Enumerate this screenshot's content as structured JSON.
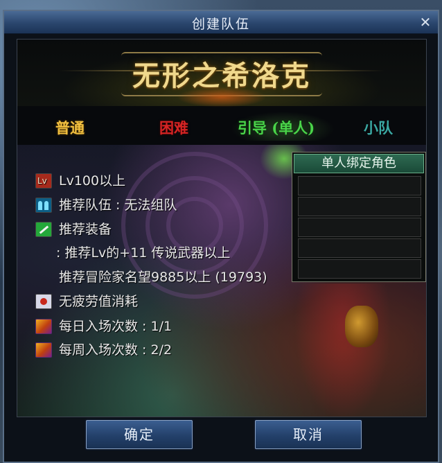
{
  "window": {
    "title": "创建队伍",
    "close_glyph": "✕"
  },
  "banner": {
    "title": "无形之希洛克"
  },
  "tabs": [
    {
      "label": "普通",
      "color": "#f2c040"
    },
    {
      "label": "困难",
      "color": "#d62424"
    },
    {
      "label": "引导 (单人)",
      "color": "#4ad44a",
      "selected": true
    },
    {
      "label": "小队",
      "color": "#3aa8a2"
    }
  ],
  "info": {
    "level": {
      "icon": "level-icon",
      "text": "Lv100以上"
    },
    "team": {
      "icon": "team-icon",
      "text": "推荐队伍 : 无法组队"
    },
    "equipment": {
      "icon": "equipment-icon",
      "text": "推荐装备"
    },
    "equipment_detail": ": 推荐Lv的+11 传说武器以上",
    "reputation": "推荐冒险家名望9885以上 (19793)",
    "fatigue": {
      "icon": "fatigue-icon",
      "text": "无疲劳值消耗"
    },
    "daily_entries": {
      "icon": "ticket-icon",
      "text": "每日入场次数 : 1/1"
    },
    "weekly_entries": {
      "icon": "ticket-icon",
      "text": "每周入场次数 : 2/2"
    }
  },
  "bind_panel": {
    "header": "单人绑定角色",
    "slot_count": 5
  },
  "buttons": {
    "confirm": "确定",
    "cancel": "取消"
  }
}
